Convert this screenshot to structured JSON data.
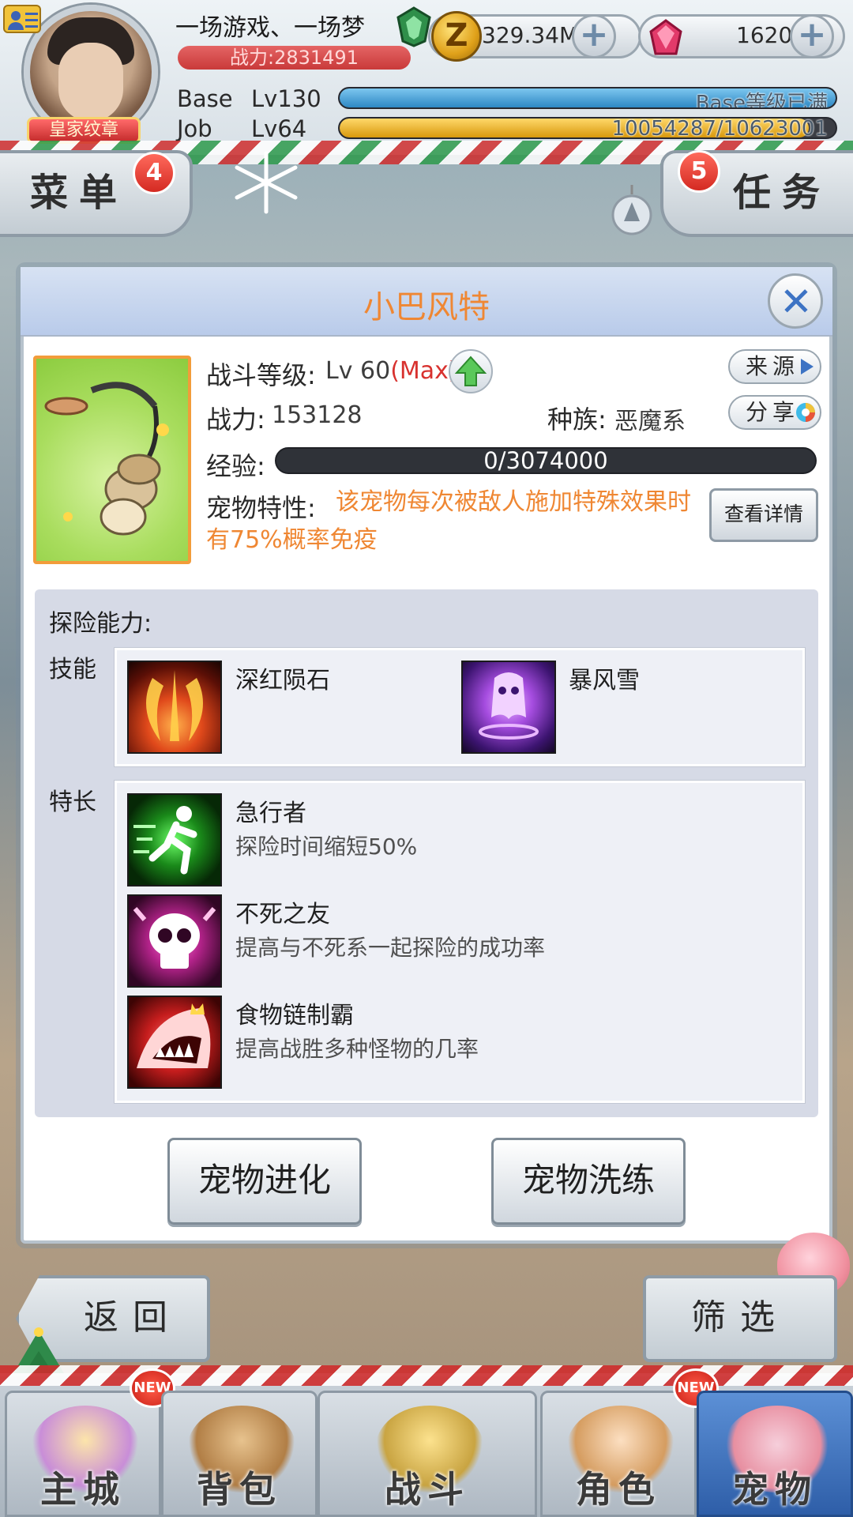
{
  "player": {
    "name": "一场游戏、一场梦",
    "power": "战力:2831491",
    "badge": "皇家纹章",
    "base_label": "Base",
    "base_level": "Lv130",
    "base_exp_text": "Base等级已满",
    "base_exp_fraction": 1.0,
    "job_label": "Job",
    "job_level": "Lv64",
    "job_exp_text": "10054287/10623001",
    "job_exp_fraction": 0.946
  },
  "currency": {
    "zeny": "329.34M",
    "zeny_symbol": "Z",
    "gems": "1620",
    "plus": "+"
  },
  "tabs": {
    "menu_label": "菜单",
    "menu_count": "4",
    "task_label": "任务",
    "task_count": "5"
  },
  "pet": {
    "title": "小巴风特",
    "combat_level_label": "战斗等级:",
    "combat_level_value": "Lv 60",
    "combat_level_max": "(Max)",
    "power_label": "战力:",
    "power_value": "153128",
    "race_label": "种族:",
    "race_value": "恶魔系",
    "exp_label": "经验:",
    "exp_value": "0/3074000",
    "exp_fraction": 0.0,
    "trait_label": "宠物特性:",
    "trait_text": "该宠物每次被敌人施加特殊效果时有75%概率免疫",
    "source_button": "来源",
    "share_button": "分享",
    "detail_button": "查看详情",
    "close_symbol": "✕"
  },
  "explore": {
    "title": "探险能力:",
    "skills_label": "技能",
    "specials_label": "特长",
    "skills": [
      {
        "name": "深红陨石",
        "icon": "crimson-meteor-icon"
      },
      {
        "name": "暴风雪",
        "icon": "blizzard-ghost-icon"
      }
    ],
    "specials": [
      {
        "name": "急行者",
        "desc": "探险时间缩短50%",
        "icon": "runner-icon"
      },
      {
        "name": "不死之友",
        "desc": "提高与不死系一起探险的成功率",
        "icon": "skull-icon"
      },
      {
        "name": "食物链制霸",
        "desc": "提高战胜多种怪物的几率",
        "icon": "shark-icon"
      }
    ]
  },
  "actions": {
    "evolve": "宠物进化",
    "refine": "宠物洗练"
  },
  "bottom": {
    "back": "返回",
    "filter": "筛选",
    "new_badge": "NEW",
    "nav": [
      {
        "label": "主城",
        "new": true
      },
      {
        "label": "背包",
        "new": false
      },
      {
        "label": "战斗",
        "new": false
      },
      {
        "label": "角色",
        "new": true
      },
      {
        "label": "宠物",
        "new": false
      }
    ]
  },
  "colors": {
    "accent_orange": "#ef8733",
    "max_red": "#d8322f",
    "base_bar": "#3f9ad2",
    "job_bar": "#e9b21a",
    "nav_active": "#2e5ea8"
  }
}
